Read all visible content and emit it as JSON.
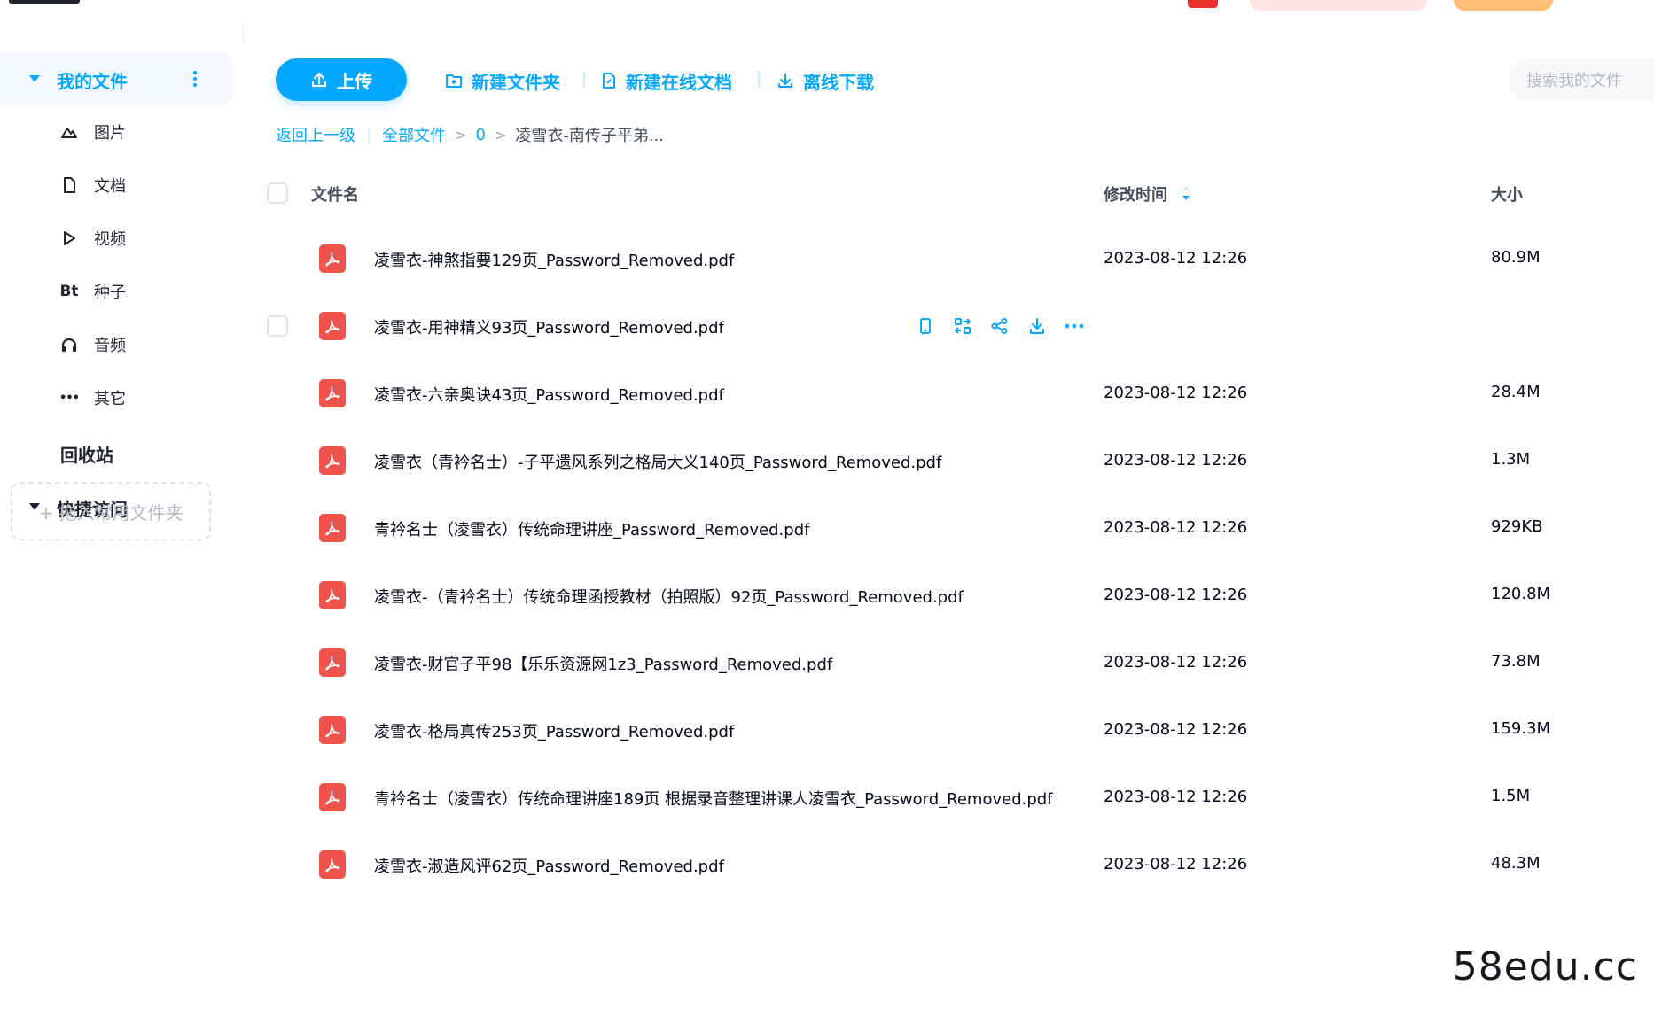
{
  "sidebar": {
    "my_files": "我的文件",
    "items": [
      {
        "label": "图片",
        "icon": "image-icon"
      },
      {
        "label": "文档",
        "icon": "document-icon"
      },
      {
        "label": "视频",
        "icon": "video-icon"
      },
      {
        "label": "种子",
        "icon": "bt-icon",
        "glyph": "Bt"
      },
      {
        "label": "音频",
        "icon": "headphones-icon"
      },
      {
        "label": "其它",
        "icon": "more-icon",
        "glyph": "•••"
      }
    ],
    "recycle_bin": "回收站",
    "quick_access": "快捷访问",
    "drop_hint": "+ 拖入常用文件夹"
  },
  "toolbar": {
    "upload": "上传",
    "new_folder": "新建文件夹",
    "new_online_doc": "新建在线文档",
    "offline_download": "离线下载",
    "search_placeholder": "搜索我的文件"
  },
  "breadcrumb": {
    "back": "返回上一级",
    "all_files": "全部文件",
    "level1": "0",
    "current": "凌雪衣-南传子平弟..."
  },
  "table": {
    "col_name": "文件名",
    "col_modified": "修改时间",
    "col_size": "大小",
    "rows": [
      {
        "name": "凌雪衣-神煞指要129页_Password_Removed.pdf",
        "modified": "2023-08-12 12:26",
        "size": "80.9M"
      },
      {
        "name": "凌雪衣-用神精义93页_Password_Removed.pdf",
        "modified": "",
        "size": "",
        "hovered": true
      },
      {
        "name": "凌雪衣-六亲奥诀43页_Password_Removed.pdf",
        "modified": "2023-08-12 12:26",
        "size": "28.4M"
      },
      {
        "name": "凌雪衣（青衿名士）-子平遗风系列之格局大义140页_Password_Removed.pdf",
        "modified": "2023-08-12 12:26",
        "size": "1.3M"
      },
      {
        "name": "青衿名士（凌雪衣）传统命理讲座_Password_Removed.pdf",
        "modified": "2023-08-12 12:26",
        "size": "929KB"
      },
      {
        "name": "凌雪衣-（青衿名士）传统命理函授教材（拍照版）92页_Password_Removed.pdf",
        "modified": "2023-08-12 12:26",
        "size": "120.8M"
      },
      {
        "name": "凌雪衣-财官子平98【乐乐资源网1z3_Password_Removed.pdf",
        "modified": "2023-08-12 12:26",
        "size": "73.8M"
      },
      {
        "name": "凌雪衣-格局真传253页_Password_Removed.pdf",
        "modified": "2023-08-12 12:26",
        "size": "159.3M"
      },
      {
        "name": "青衿名士（凌雪衣）传统命理讲座189页 根据录音整理讲课人凌雪衣_Password_Removed.pdf",
        "modified": "2023-08-12 12:26",
        "size": "1.5M"
      },
      {
        "name": "凌雪衣-淑造风评62页_Password_Removed.pdf",
        "modified": "2023-08-12 12:26",
        "size": "48.3M"
      }
    ]
  },
  "row_actions": [
    "phone-icon",
    "convert-icon",
    "share-icon",
    "download-icon",
    "more-icon"
  ],
  "watermark": "58edu.cc",
  "colors": {
    "accent": "#06a7ff",
    "pdf": "#f0524d",
    "text": "#03081a",
    "muted": "#454d5a"
  }
}
